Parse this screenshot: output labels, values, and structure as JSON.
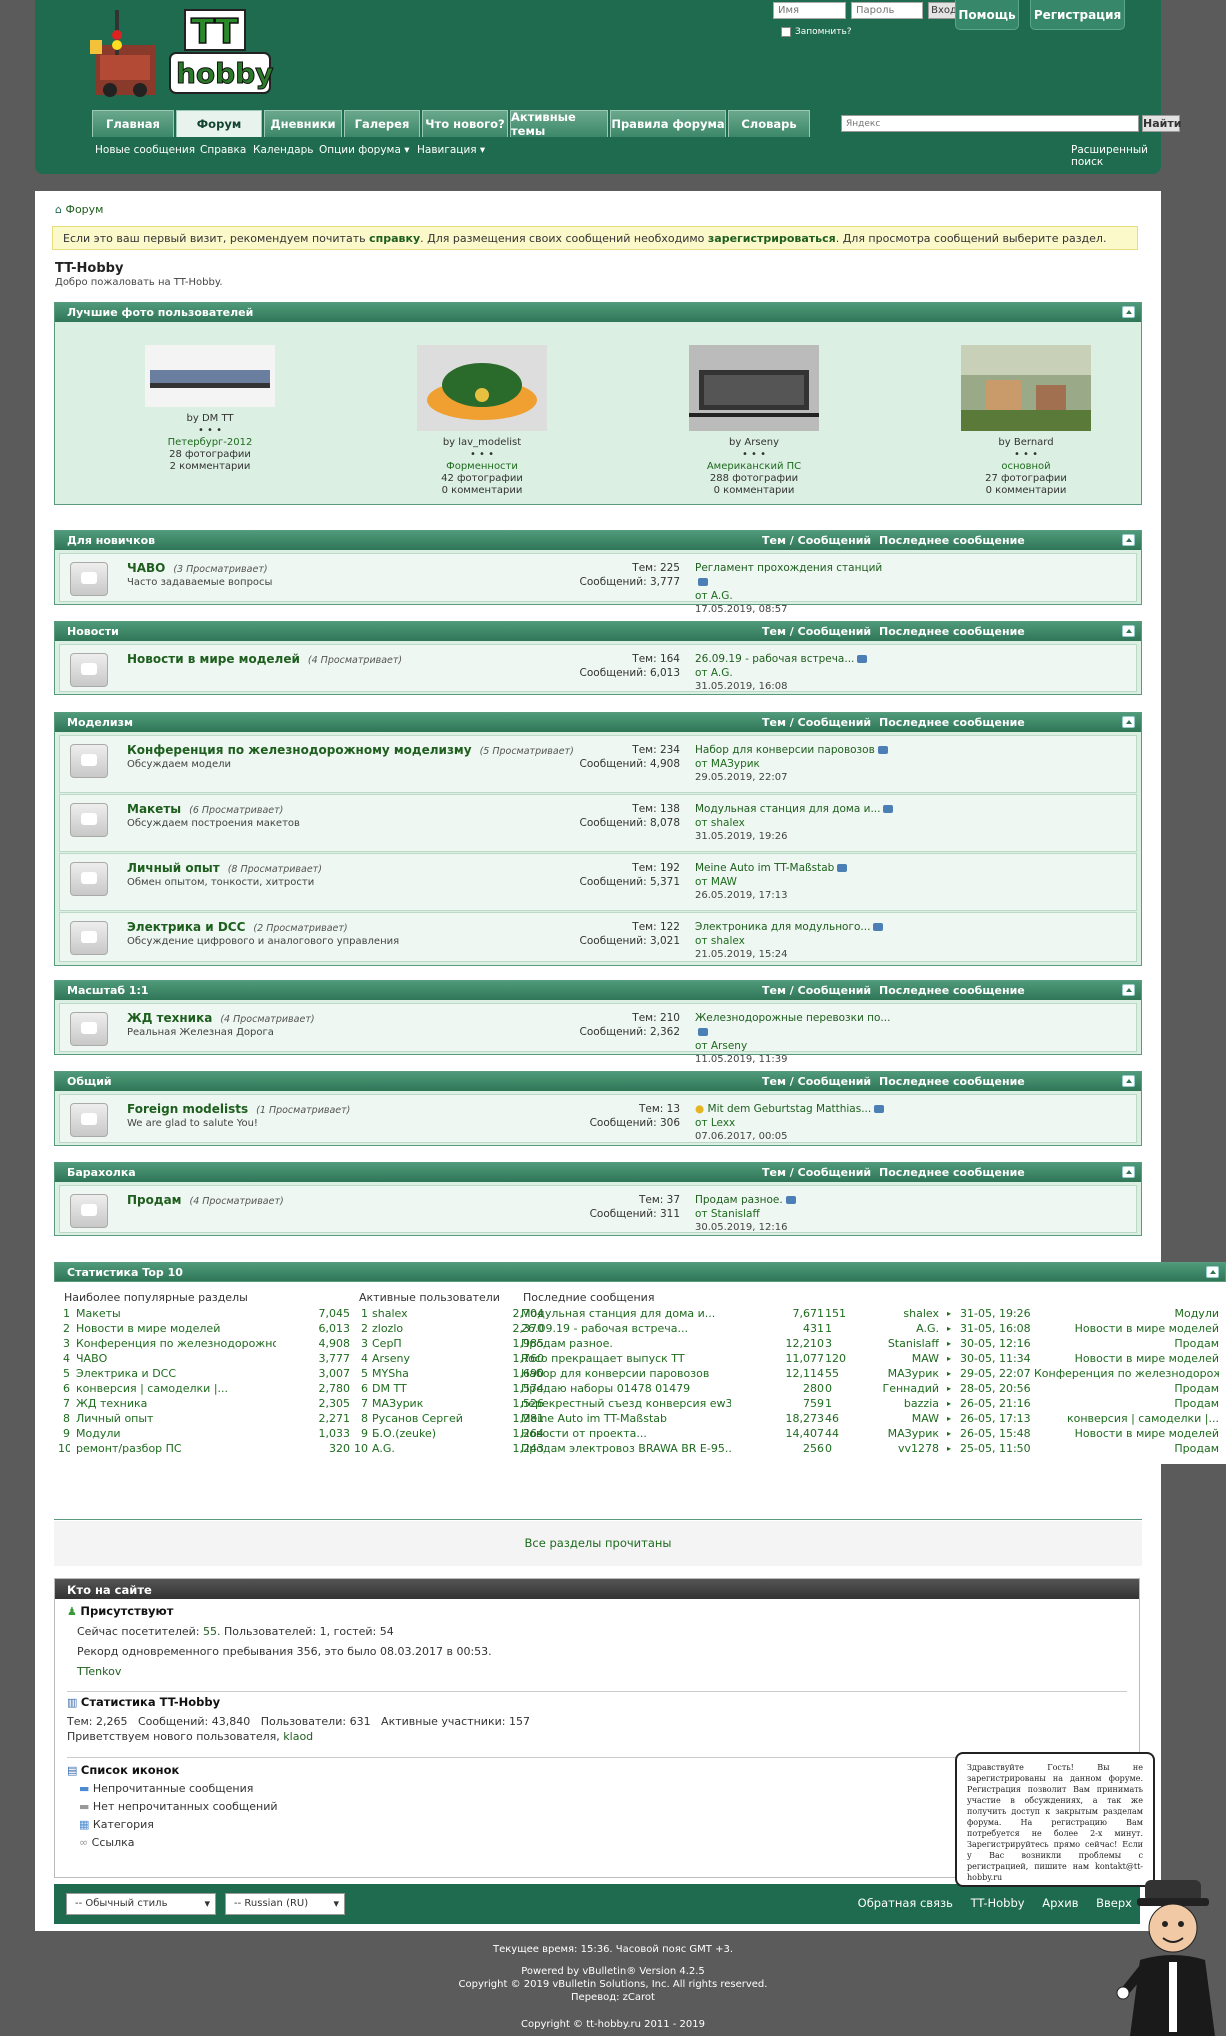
{
  "header": {
    "login": {
      "username_placeholder": "Имя",
      "password_placeholder": "Пароль",
      "login_button": "Вход",
      "remember": "Запомнить?"
    },
    "help_button": "Помощь",
    "register_button": "Регистрация",
    "tabs": [
      "Главная",
      "Форум",
      "Дневники",
      "Галерея",
      "Что нового?",
      "Активные темы",
      "Правила форума",
      "Словарь"
    ],
    "search_placeholder": "Яндекс",
    "search_button": "Найти",
    "subnav": [
      "Новые сообщения",
      "Справка",
      "Календарь",
      "Опции форума",
      "Навигация"
    ],
    "advanced_search": "Расширенный поиск",
    "logo_text": "TT hobby"
  },
  "breadcrumb": "Форум",
  "notice": {
    "pre": "Если это ваш первый визит, рекомендуем почитать ",
    "link1": "справку",
    "mid": ". Для размещения своих сообщений необходимо ",
    "link2": "зарегистрироваться",
    "post": ". Для просмотра сообщений выберите раздел."
  },
  "site": {
    "title": "TT-Hobby",
    "welcome": "Добро пожаловать на TT-Hobby."
  },
  "gallery": {
    "title": "Лучшие фото пользователей",
    "items": [
      {
        "by": "by DM TT",
        "dots": "• • •",
        "album": "Петербург-2012",
        "photos": "28 фотографии",
        "comments": "2 комментарии"
      },
      {
        "by": "by lav_modelist",
        "dots": "• • •",
        "album": "Форменности",
        "photos": "42 фотографии",
        "comments": "0 комментарии"
      },
      {
        "by": "by Arseny",
        "dots": "• • •",
        "album": "Американский ПС",
        "photos": "288 фотографии",
        "comments": "0 комментарии"
      },
      {
        "by": "by Bernard",
        "dots": "• • •",
        "album": "основной",
        "photos": "27 фотографии",
        "comments": "0 комментарии"
      }
    ]
  },
  "col_threads": "Тем / Сообщений",
  "col_last": "Последнее сообщение",
  "categories": [
    {
      "name": "Для новичков",
      "forums": [
        {
          "title": "ЧАВО",
          "viewing": "(3 Просматривает)",
          "desc": "Часто задаваемые вопросы",
          "threads": "Тем: 225",
          "posts": "Сообщений: 3,777",
          "last_title": "Регламент прохождения станций",
          "last_by": "от A.G.",
          "last_date": "17.05.2019, 08:57"
        }
      ]
    },
    {
      "name": "Новости",
      "forums": [
        {
          "title": "Новости в мире моделей",
          "viewing": "(4 Просматривает)",
          "desc": "",
          "threads": "Тем: 164",
          "posts": "Сообщений: 6,013",
          "last_title": "26.09.19 - рабочая встреча...",
          "last_by": "от A.G.",
          "last_date": "31.05.2019, 16:08"
        }
      ]
    },
    {
      "name": "Моделизм",
      "forums": [
        {
          "title": "Конференция по железнодорожному моделизму",
          "viewing": "(5 Просматривает)",
          "desc": "Обсуждаем модели",
          "threads": "Тем: 234",
          "posts": "Сообщений: 4,908",
          "last_title": "Набор для конверсии паровозов",
          "last_by": "от МАЗурик",
          "last_date": "29.05.2019, 22:07"
        },
        {
          "title": "Макеты",
          "viewing": "(6 Просматривает)",
          "desc": "Обсуждаем построения макетов",
          "threads": "Тем: 138",
          "posts": "Сообщений: 8,078",
          "last_title": "Модульная станция для дома и...",
          "last_by": "от shalex",
          "last_date": "31.05.2019, 19:26"
        },
        {
          "title": "Личный опыт",
          "viewing": "(8 Просматривает)",
          "desc": "Обмен опытом, тонкости, хитрости",
          "threads": "Тем: 192",
          "posts": "Сообщений: 5,371",
          "last_title": "Meine Auto im TT-Maßstab",
          "last_by": "от MAW",
          "last_date": "26.05.2019, 17:13"
        },
        {
          "title": "Электрика и DCC",
          "viewing": "(2 Просматривает)",
          "desc": "Обсуждение цифрового и аналогового управления",
          "threads": "Тем: 122",
          "posts": "Сообщений: 3,021",
          "last_title": "Электроника для модульного...",
          "last_by": "от shalex",
          "last_date": "21.05.2019, 15:24"
        }
      ]
    },
    {
      "name": "Масштаб 1:1",
      "forums": [
        {
          "title": "ЖД техника",
          "viewing": "(4 Просматривает)",
          "desc": "Реальная Железная Дорога",
          "threads": "Тем: 210",
          "posts": "Сообщений: 2,362",
          "last_title": "Железнодорожные перевозки по...",
          "last_by": "от Arseny",
          "last_date": "11.05.2019, 11:39"
        }
      ]
    },
    {
      "name": "Общий",
      "forums": [
        {
          "title": "Foreign modelists",
          "viewing": "(1 Просматривает)",
          "desc": "We are glad to salute You!",
          "threads": "Тем: 13",
          "posts": "Сообщений: 306",
          "last_title": "Mit dem Geburtstag Matthias...",
          "last_by": "от Lexx",
          "last_date": "07.06.2017, 00:05"
        }
      ]
    },
    {
      "name": "Барахолка",
      "forums": [
        {
          "title": "Продам",
          "viewing": "(4 Просматривает)",
          "desc": "",
          "threads": "Тем: 37",
          "posts": "Сообщений: 311",
          "last_title": "Продам разное.",
          "last_by": "от Stanislaff",
          "last_date": "30.05.2019, 12:16"
        }
      ]
    }
  ],
  "stats": {
    "title": "Статистика Top 10",
    "h_sections": "Наиболее популярные разделы",
    "h_users": "Активные пользователи",
    "h_posts": "Последние сообщения",
    "sections": [
      [
        "1",
        "Макеты",
        "7,045"
      ],
      [
        "2",
        "Новости в мире моделей",
        "6,013"
      ],
      [
        "3",
        "Конференция по железнодорожному...",
        "4,908"
      ],
      [
        "4",
        "ЧАВО",
        "3,777"
      ],
      [
        "5",
        "Электрика и DCC",
        "3,007"
      ],
      [
        "6",
        "конверсия | самоделки |...",
        "2,780"
      ],
      [
        "7",
        "ЖД техника",
        "2,305"
      ],
      [
        "8",
        "Личный опыт",
        "2,271"
      ],
      [
        "9",
        "Модули",
        "1,033"
      ],
      [
        "10",
        "ремонт/разбор ПС",
        "320"
      ]
    ],
    "users": [
      [
        "1",
        "shalex",
        "2,704"
      ],
      [
        "2",
        "zlozlo",
        "2,370"
      ],
      [
        "3",
        "СерП",
        "1,985"
      ],
      [
        "4",
        "Arseny",
        "1,760"
      ],
      [
        "5",
        "MYSha",
        "1,690"
      ],
      [
        "6",
        "DM TT",
        "1,574"
      ],
      [
        "7",
        "МАЗурик",
        "1,526"
      ],
      [
        "8",
        "Русанов Сергей",
        "1,281"
      ],
      [
        "9",
        "Б.О.(zeuke)",
        "1,264"
      ],
      [
        "10",
        "A.G.",
        "1,243"
      ]
    ],
    "posts": [
      [
        "Модульная станция для дома и...",
        "7,671",
        "151",
        "shalex",
        "31-05, 19:26",
        "Модули"
      ],
      [
        "26.09.19 - рабочая встреча...",
        "431",
        "1",
        "A.G.",
        "31-05, 16:08",
        "Новости в мире моделей"
      ],
      [
        "Продам разное.",
        "12,210",
        "3",
        "Stanislaff",
        "30-05, 12:16",
        "Продам"
      ],
      [
        "Roco прекращает выпуск TT",
        "11,077",
        "120",
        "MAW",
        "30-05, 11:34",
        "Новости в мире моделей"
      ],
      [
        "Набор для конверсии паровозов",
        "12,114",
        "55",
        "МАЗурик",
        "29-05, 22:07",
        "Конференция по железнодорожному..."
      ],
      [
        "Продаю наборы 01478 01479",
        "280",
        "0",
        "Геннадий",
        "28-05, 20:56",
        "Продам"
      ],
      [
        "перекрестный съезд конверсия ew3",
        "759",
        "1",
        "bazzia",
        "26-05, 21:16",
        "Продам"
      ],
      [
        "Meine Auto im TT-Maßstab",
        "18,273",
        "46",
        "MAW",
        "26-05, 17:13",
        "конверсия | самоделки |..."
      ],
      [
        "Новости от проекта...",
        "14,407",
        "44",
        "МАЗурик",
        "26-05, 15:48",
        "Новости в мире моделей"
      ],
      [
        "Продам электровоз BRAWA BR E-95...",
        "256",
        "0",
        "vv1278",
        "25-05, 11:50",
        "Продам"
      ]
    ]
  },
  "all_read": "Все разделы прочитаны",
  "online": {
    "title": "Кто на сайте",
    "present_h": "Присутствуют",
    "visitors_pre": "Сейчас посетителей: ",
    "visitors": "55.",
    "visitors_post": " Пользователей: 1, гостей: 54",
    "record": "Рекорд одновременного пребывания 356, это было 08.03.2017 в 00:53.",
    "user": "TTenkov",
    "stats_h": "Статистика TT-Hobby",
    "stats_line": "Тем: 2,265   Сообщений: 43,840   Пользователи: 631   Активные участники: 157",
    "welcome_pre": "Приветствуем нового пользователя, ",
    "welcome_user": "klaod",
    "icons_h": "Список иконок",
    "icons": [
      "Непрочитанные сообщения",
      "Нет непрочитанных сообщений",
      "Категория",
      "Ссылка"
    ]
  },
  "footer": {
    "style_select": "-- Обычный стиль",
    "lang_select": "-- Russian (RU)",
    "links": [
      "Обратная связь",
      "TT-Hobby",
      "Архив",
      "Вверх"
    ],
    "time": "Текущее время: 15:36. Часовой пояс GMT +3.",
    "powered": "Powered by vBulletin® Version 4.2.5",
    "copyright": "Copyright © 2019 vBulletin Solutions, Inc. All rights reserved.",
    "translate": "Перевод: zCarot",
    "site_copy": "Copyright © tt-hobby.ru 2011 - 2019"
  },
  "balloon": "Здравствуйте Гость! Вы не зарегистрированы на данном форуме. Регистрация позволит Вам принимать участие в обсуждениях, а так же получить доступ к закрытым разделам форума. На регистрацию Вам потребуется не более 2-х минут. Зарегистрируйтесь прямо сейчас! Если у Вас возникли проблемы с регистрацией, пишите нам kontakt@tt-hobby.ru"
}
